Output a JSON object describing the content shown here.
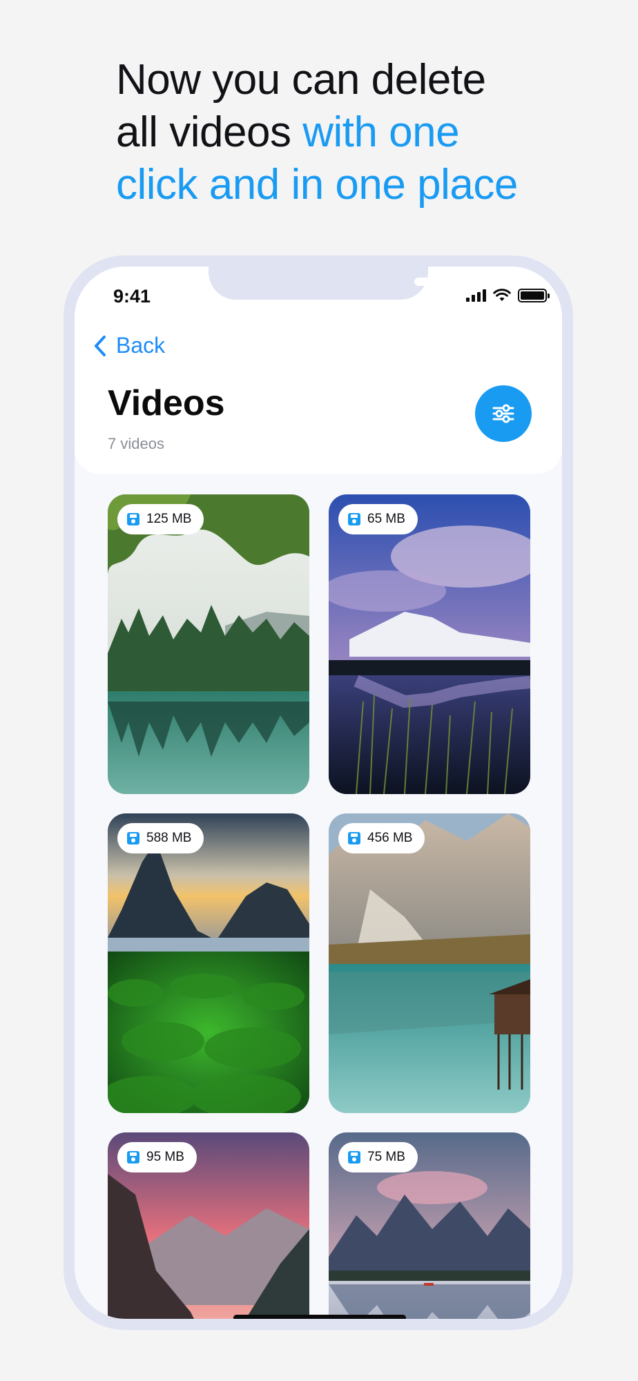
{
  "headline": {
    "line1": "Now you can delete",
    "line2_plain": "all videos ",
    "line2_accent": "with one",
    "line3_accent": "click and in one place"
  },
  "status": {
    "time": "9:41"
  },
  "nav": {
    "back_label": "Back"
  },
  "page": {
    "title": "Videos",
    "subtitle": "7 videos"
  },
  "videos": [
    {
      "size": "125 MB",
      "scene": "forest-lake"
    },
    {
      "size": "65 MB",
      "scene": "mountain-lake-dusk"
    },
    {
      "size": "588 MB",
      "scene": "fjord-moss"
    },
    {
      "size": "456 MB",
      "scene": "alpine-lake-cabin"
    },
    {
      "size": "95 MB",
      "scene": "valley-sunset"
    },
    {
      "size": "75 MB",
      "scene": "mountain-reflection"
    }
  ],
  "colors": {
    "accent": "#1a9bf2",
    "link": "#1d8cf8"
  }
}
